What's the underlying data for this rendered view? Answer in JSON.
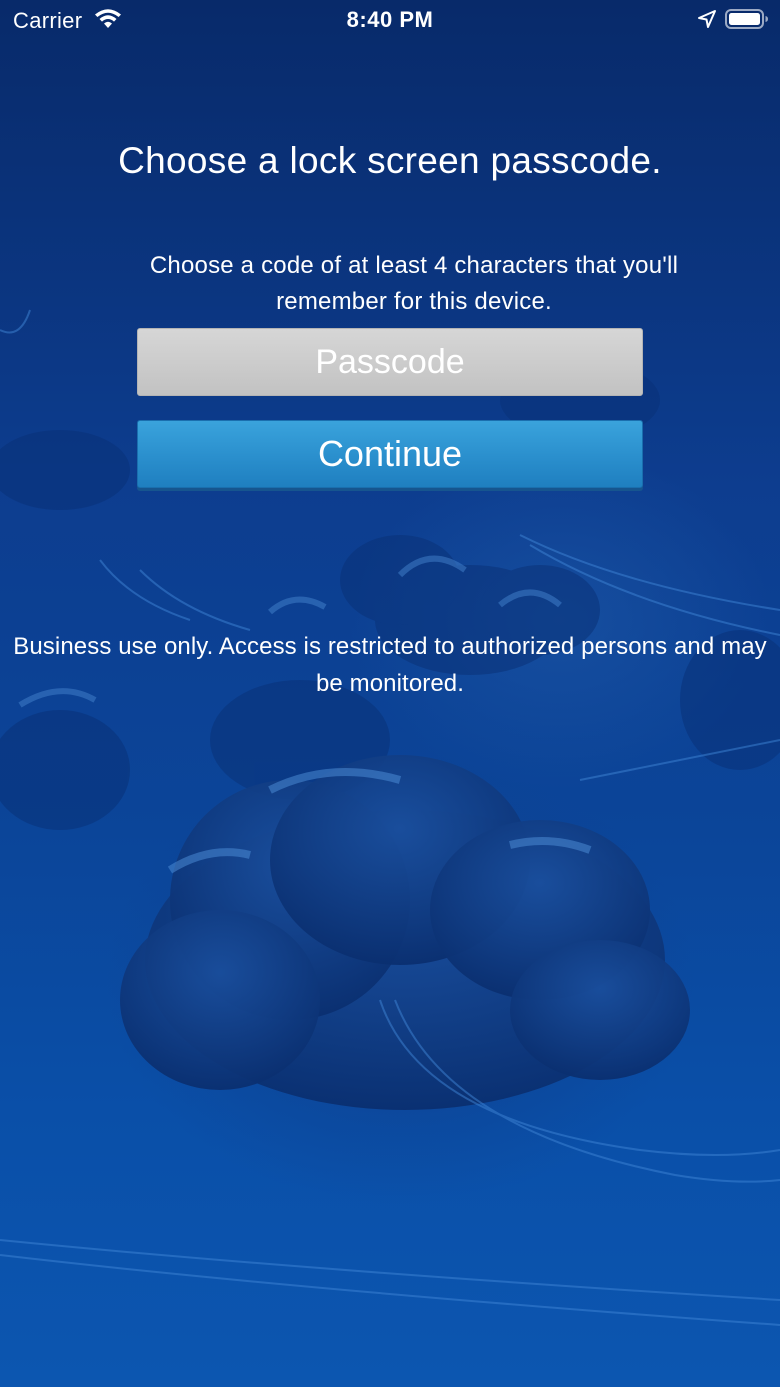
{
  "status_bar": {
    "carrier": "Carrier",
    "time": "8:40 PM",
    "icons": [
      "wifi-icon",
      "location-arrow-icon",
      "battery-icon"
    ]
  },
  "screen": {
    "title": "Choose a lock screen passcode.",
    "subtitle": "Choose a code of at least 4 characters that you'll remember for this device.",
    "passcode": {
      "placeholder": "Passcode",
      "value": ""
    },
    "continue_label": "Continue",
    "disclaimer": "Business use only. Access is restricted to authorized persons and may be monitored."
  },
  "colors": {
    "background_top": "#082a6a",
    "background_bottom": "#0c56b0",
    "input_fill": "#c8c8c8",
    "button_fill": "#2a8fcd",
    "text": "#ffffff"
  }
}
